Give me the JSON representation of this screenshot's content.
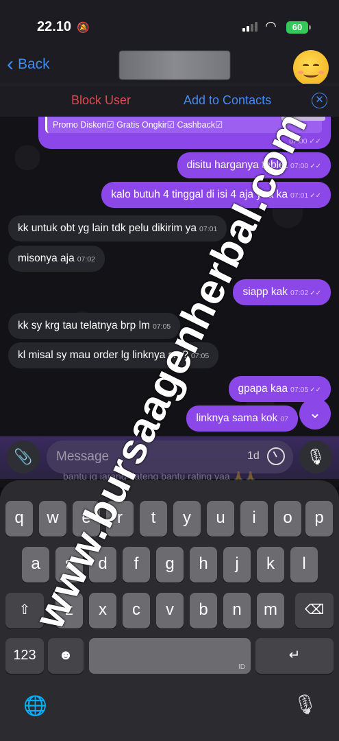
{
  "status_bar": {
    "time": "22.10",
    "battery": "60"
  },
  "nav": {
    "back_label": "Back",
    "chevron_icon": "chevron-left-icon"
  },
  "actions": {
    "block_user": "Block User",
    "add_to_contacts": "Add to Contacts"
  },
  "promo": {
    "text": "Promo Diskon☑ Gratis Ongkir☑ Cashback☑",
    "time": "07:00",
    "check": "✓✓"
  },
  "messages": [
    {
      "dir": "out",
      "text": "disitu harganya tablet",
      "time": "07:00",
      "check": "✓✓"
    },
    {
      "dir": "out",
      "text": "kalo butuh 4 tinggal di isi 4 aja yaa ka",
      "time": "07:01",
      "check": "✓✓"
    },
    {
      "dir": "in",
      "text": "kk untuk obt yg lain tdk pelu dikirim ya",
      "time": "07:01"
    },
    {
      "dir": "in",
      "text": "misonya aja",
      "time": "07:02"
    },
    {
      "dir": "out",
      "text": "siapp kak",
      "time": "07:02",
      "check": "✓✓"
    },
    {
      "dir": "in",
      "text": "kk sy krg tau telatnya brp lm",
      "time": "07:05"
    },
    {
      "dir": "in",
      "text": "kl misal sy mau order lg linknya sm?",
      "time": "07:05"
    },
    {
      "dir": "out",
      "text": "gpapa kaa",
      "time": "07:05",
      "check": "✓✓"
    },
    {
      "dir": "out",
      "text": "linknya sama kok",
      "time": "07"
    }
  ],
  "input": {
    "placeholder": "Message",
    "timer_label": "1d",
    "ghost_text": "bantu jg jarang dateng bantu rating yaa 🙏🙏"
  },
  "keyboard": {
    "row1": [
      "q",
      "w",
      "e",
      "r",
      "t",
      "y",
      "u",
      "i",
      "o",
      "p"
    ],
    "row2": [
      "a",
      "s",
      "d",
      "f",
      "g",
      "h",
      "j",
      "k",
      "l"
    ],
    "row3": [
      "z",
      "x",
      "c",
      "v",
      "b",
      "n",
      "m"
    ],
    "numbers_key": "123",
    "space_label": "ID",
    "shift_icon": "⇧",
    "backspace_icon": "⌫",
    "return_icon": "↵",
    "emoji_icon": "☻",
    "globe_icon": "🌐",
    "mic_icon": "🎙"
  },
  "watermark": "www.bursaagenherbal.com",
  "colors": {
    "accent": "#8c47e8",
    "link": "#3e8cf5",
    "danger": "#e5484d",
    "incoming": "#26262d"
  }
}
